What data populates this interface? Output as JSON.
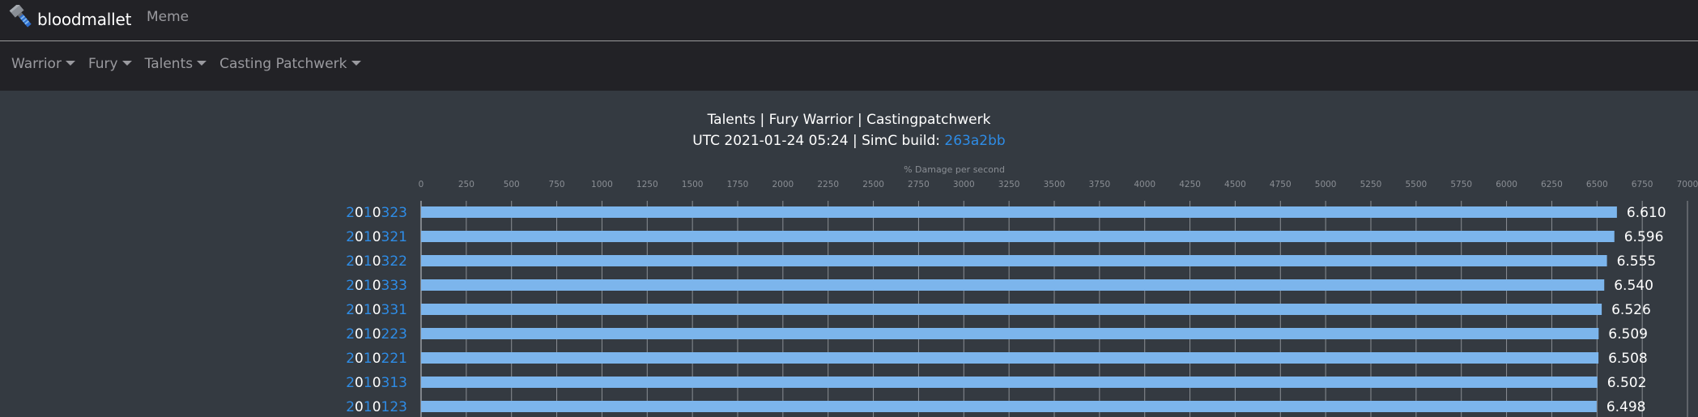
{
  "navbar": {
    "brand": "bloodmallet",
    "brand_icon": "mallet-icon",
    "links": [
      "Meme"
    ]
  },
  "subnav": {
    "dropdowns": [
      "Warrior",
      "Fury",
      "Talents",
      "Casting Patchwerk"
    ]
  },
  "header": {
    "title": "Talents | Fury Warrior | Castingpatchwerk",
    "subtitle_prefix": "UTC 2021-01-24 05:24 | SimC build: ",
    "build": "263a2bb"
  },
  "colors": {
    "bar": "#7cb5ec",
    "talent_digit_selected": "#2e8ce6",
    "talent_digit_zero": "#ffffff",
    "grid": "#8a8e94",
    "page_bg": "#343a41",
    "navbar_bg": "#222226"
  },
  "chart_data": {
    "type": "bar",
    "orientation": "horizontal",
    "title": "Talents | Fury Warrior | Castingpatchwerk",
    "subtitle": "UTC 2021-01-24 05:24 | SimC build: 263a2bb",
    "xlabel": "% Damage per second",
    "ylabel": "",
    "xlim": [
      0,
      7000
    ],
    "xticks": [
      0,
      250,
      500,
      750,
      1000,
      1250,
      1500,
      1750,
      2000,
      2250,
      2500,
      2750,
      3000,
      3250,
      3500,
      3750,
      4000,
      4250,
      4500,
      4750,
      5000,
      5250,
      5500,
      5750,
      6000,
      6250,
      6500,
      6750,
      7000
    ],
    "grid": true,
    "legend": "none",
    "categories": [
      "2010323",
      "2010321",
      "2010322",
      "2010333",
      "2010331",
      "2010223",
      "2010221",
      "2010313",
      "2010123"
    ],
    "values": [
      6610,
      6596,
      6555,
      6540,
      6526,
      6509,
      6508,
      6502,
      6498
    ],
    "value_labels": [
      "6.610",
      "6.596",
      "6.555",
      "6.540",
      "6.526",
      "6.509",
      "6.508",
      "6.502",
      "6.498"
    ]
  }
}
